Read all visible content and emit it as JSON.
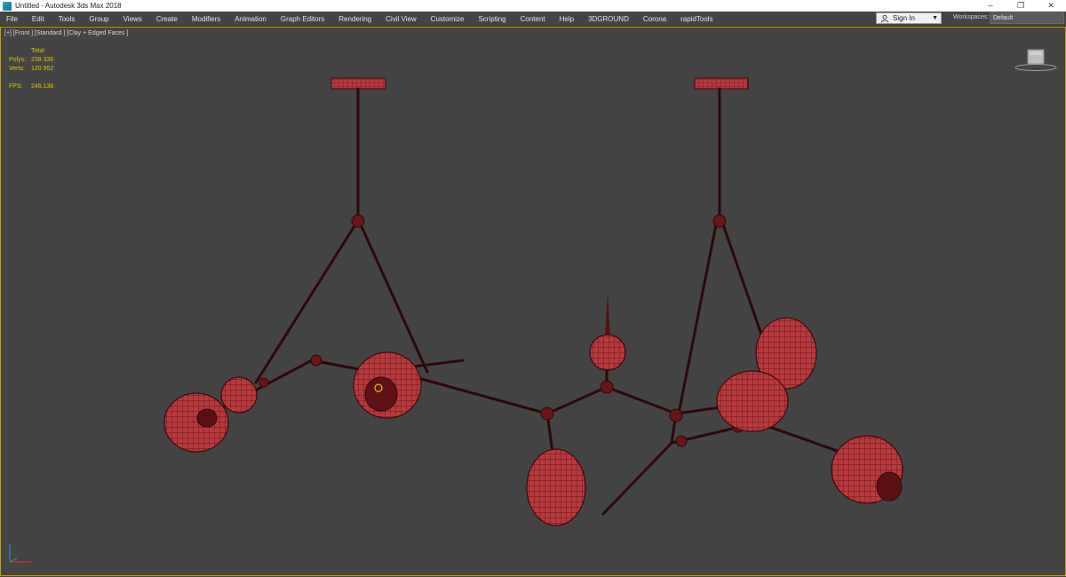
{
  "window": {
    "title": "Untitled - Autodesk 3ds Max 2018",
    "controls": {
      "minimize": "–",
      "restore": "❐",
      "close": "✕"
    }
  },
  "menu": {
    "items": [
      "File",
      "Edit",
      "Tools",
      "Group",
      "Views",
      "Create",
      "Modifiers",
      "Animation",
      "Graph Editors",
      "Rendering",
      "Civil View",
      "Customize",
      "Scripting",
      "Content",
      "Help",
      "3DGROUND",
      "Corona",
      "rapidTools"
    ]
  },
  "account": {
    "signin_label": "Sign In"
  },
  "workspaces": {
    "label": "Workspaces:",
    "value": "Default"
  },
  "viewport": {
    "label": "[+] [Front ] [Standard ] [Clay + Edged Faces ]",
    "stats": {
      "total_label": "Total",
      "polys_label": "Polys:",
      "polys_value": "238 336",
      "verts_label": "Verts:",
      "verts_value": "120 952",
      "fps_label": "FPS:",
      "fps_value": "246,136"
    }
  },
  "colors": {
    "viewport_bg": "#444444",
    "model_fill": "#b8393c",
    "wire": "#3a0a0c",
    "active_border": "#c8a000",
    "stats_text": "#e0c000"
  }
}
